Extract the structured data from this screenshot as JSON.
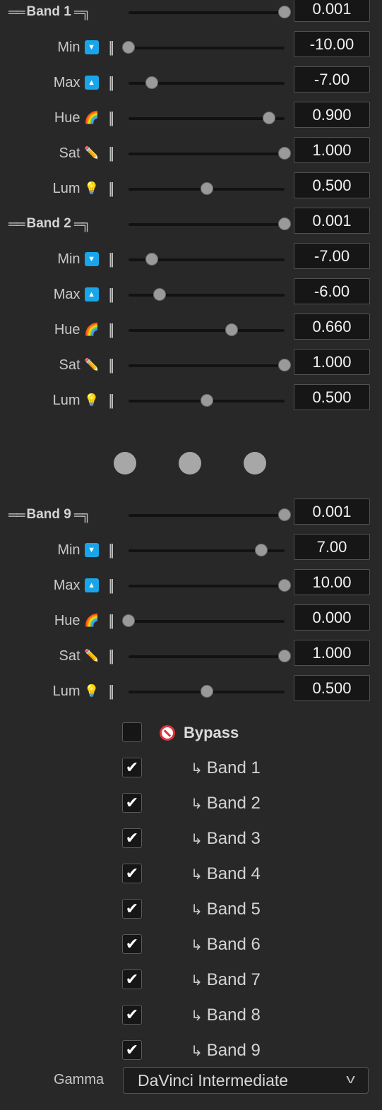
{
  "top_bands": [
    {
      "name": "Band 1",
      "strength": {
        "value": "0.001",
        "fraction": 1.0
      },
      "params": [
        {
          "label": "Min",
          "icon": "down-arrow-icon",
          "value": "-10.00",
          "fraction": 0.0
        },
        {
          "label": "Max",
          "icon": "up-arrow-icon",
          "value": "-7.00",
          "fraction": 0.15
        },
        {
          "label": "Hue",
          "icon": "rainbow-icon",
          "value": "0.900",
          "fraction": 0.9
        },
        {
          "label": "Sat",
          "icon": "pencil-icon",
          "value": "1.000",
          "fraction": 1.0
        },
        {
          "label": "Lum",
          "icon": "light-bulb-icon",
          "value": "0.500",
          "fraction": 0.5
        }
      ]
    },
    {
      "name": "Band 2",
      "strength": {
        "value": "0.001",
        "fraction": 1.0
      },
      "params": [
        {
          "label": "Min",
          "icon": "down-arrow-icon",
          "value": "-7.00",
          "fraction": 0.15
        },
        {
          "label": "Max",
          "icon": "up-arrow-icon",
          "value": "-6.00",
          "fraction": 0.2
        },
        {
          "label": "Hue",
          "icon": "rainbow-icon",
          "value": "0.660",
          "fraction": 0.66
        },
        {
          "label": "Sat",
          "icon": "pencil-icon",
          "value": "1.000",
          "fraction": 1.0
        },
        {
          "label": "Lum",
          "icon": "light-bulb-icon",
          "value": "0.500",
          "fraction": 0.5
        }
      ]
    }
  ],
  "bottom_band": {
    "name": "Band 9",
    "strength": {
      "value": "0.001",
      "fraction": 1.0
    },
    "params": [
      {
        "label": "Min",
        "icon": "down-arrow-icon",
        "value": "7.00",
        "fraction": 0.85
      },
      {
        "label": "Max",
        "icon": "up-arrow-icon",
        "value": "10.00",
        "fraction": 1.0
      },
      {
        "label": "Hue",
        "icon": "rainbow-icon",
        "value": "0.000",
        "fraction": 0.0
      },
      {
        "label": "Sat",
        "icon": "pencil-icon",
        "value": "1.000",
        "fraction": 1.0
      },
      {
        "label": "Lum",
        "icon": "light-bulb-icon",
        "value": "0.500",
        "fraction": 0.5
      }
    ]
  },
  "bypass": {
    "label": "Bypass",
    "checked": false,
    "icon": "prohibited-icon"
  },
  "band_toggles": [
    {
      "label": "Band 1",
      "checked": true
    },
    {
      "label": "Band 2",
      "checked": true
    },
    {
      "label": "Band 3",
      "checked": true
    },
    {
      "label": "Band 4",
      "checked": true
    },
    {
      "label": "Band 5",
      "checked": true
    },
    {
      "label": "Band 6",
      "checked": true
    },
    {
      "label": "Band 7",
      "checked": true
    },
    {
      "label": "Band 8",
      "checked": true
    },
    {
      "label": "Band 9",
      "checked": true
    }
  ],
  "gamma": {
    "label": "Gamma",
    "selected": "DaVinci Intermediate"
  },
  "colors": {
    "background": "#282828",
    "accent_icon": "#19a5ea",
    "slider_knob": "#9a9a9a",
    "slider_track": "#121212",
    "bypass_icon": "#e0343c"
  }
}
